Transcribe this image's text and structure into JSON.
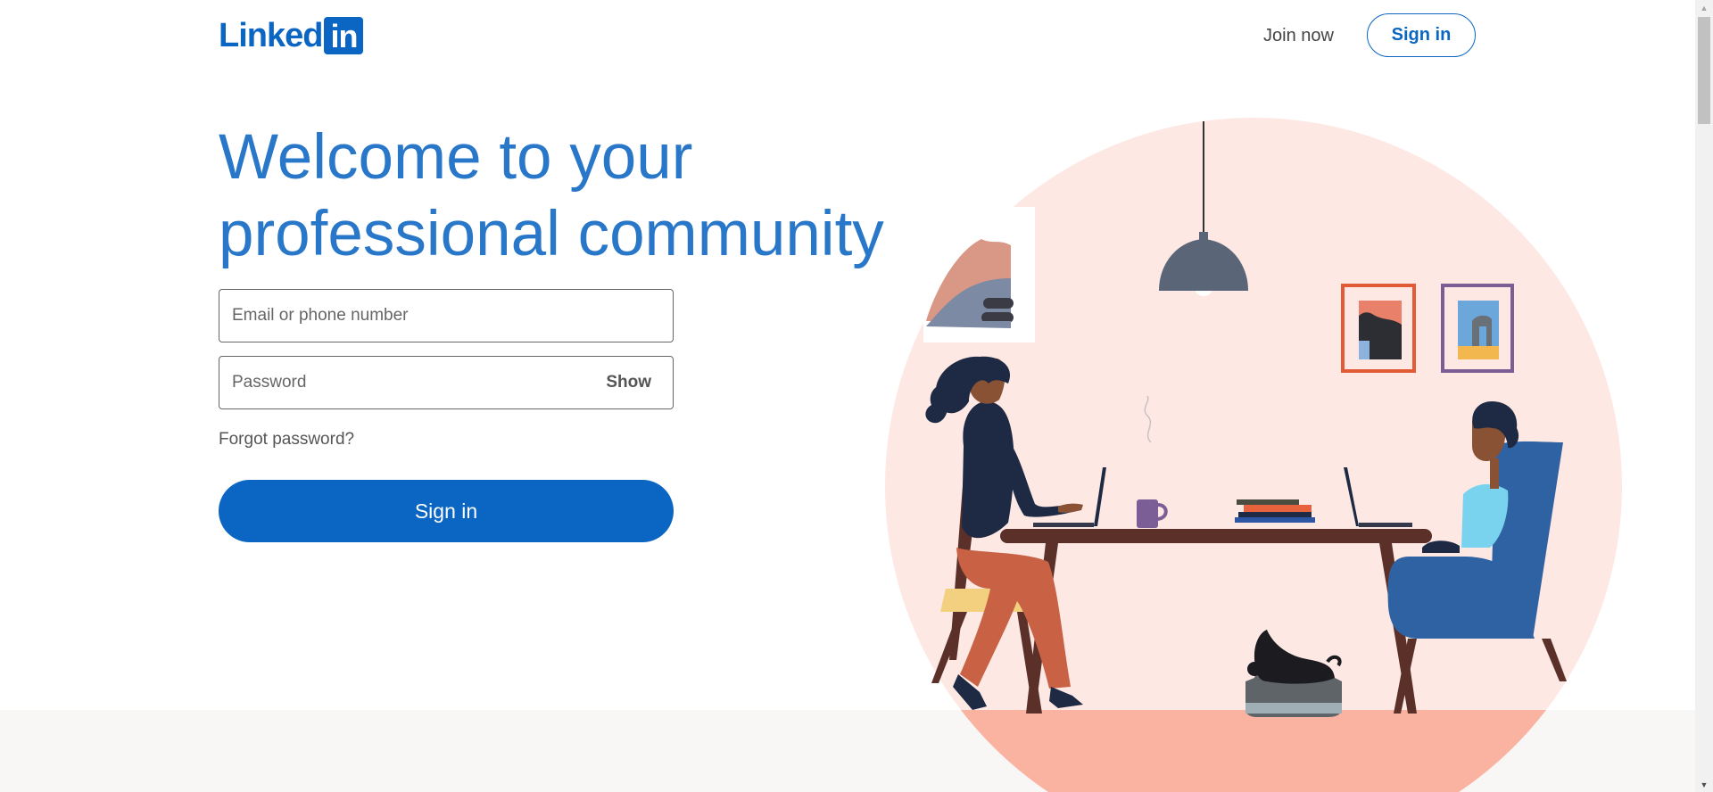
{
  "header": {
    "logo_text": "Linked",
    "logo_box_text": "in",
    "join_label": "Join now",
    "signin_label": "Sign in"
  },
  "hero": {
    "headline_line1": "Welcome to your",
    "headline_line2": "professional community",
    "email_placeholder": "Email or phone number",
    "password_placeholder": "Password",
    "show_label": "Show",
    "forgot_label": "Forgot password?",
    "signin_label": "Sign in",
    "illustration_icon": "people-working-at-table-illustration"
  },
  "colors": {
    "brand": "#0a66c2",
    "headline": "#2977c9",
    "bottom_band": "#f8f7f5",
    "illustration_bg": "#fde8e4"
  }
}
